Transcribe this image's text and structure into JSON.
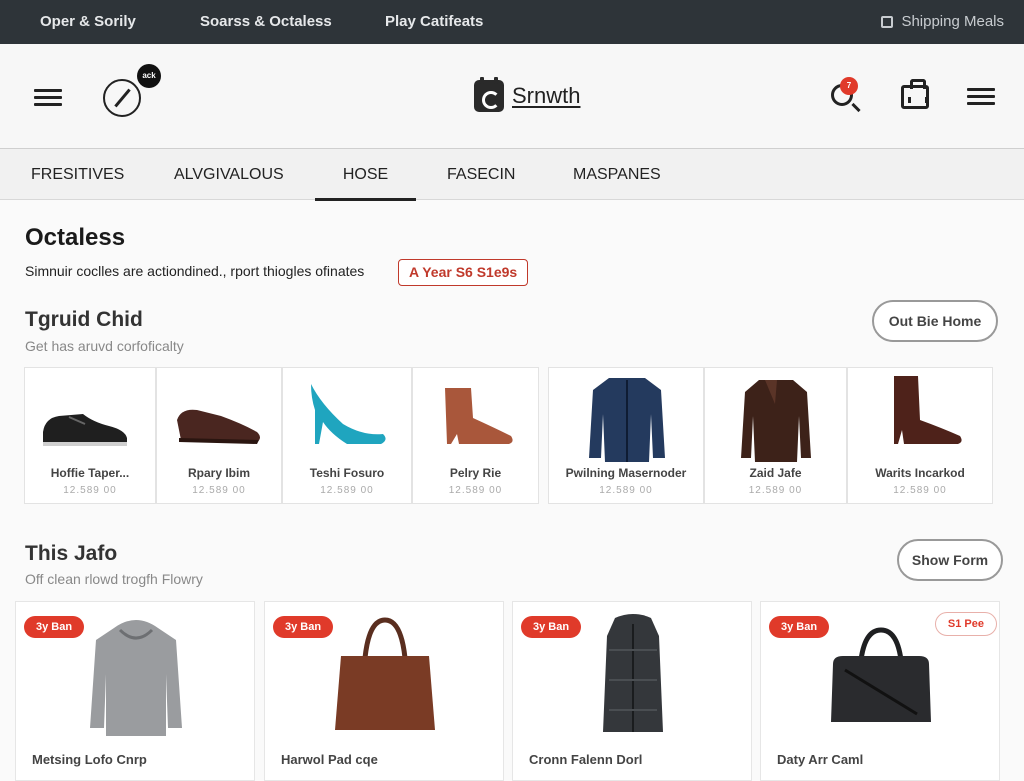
{
  "topbar": {
    "links": [
      "Oper & Sorily",
      "Soarss & Octaless",
      "Play Catifeats"
    ],
    "shipping": "Shipping Meals"
  },
  "header": {
    "compass_badge": "ack",
    "brand": "Srnwth",
    "search_badge": "7"
  },
  "tabs": [
    {
      "label": "FRESITIVES",
      "active": false
    },
    {
      "label": "ALVGIVALOUS",
      "active": false
    },
    {
      "label": "HOSE",
      "active": true
    },
    {
      "label": "FASECIN",
      "active": false
    },
    {
      "label": "MASPANES",
      "active": false
    }
  ],
  "main": {
    "title": "Octaless",
    "promo_text": "Simnuir coclles are actiondined., rport thiogles ofinates",
    "promo_badge": "A Year S6 S1e9s"
  },
  "section1": {
    "title": "Tgruid Chid",
    "subtitle": "Get has aruvd corfoficalty",
    "button": "Out Bie Home",
    "products": [
      {
        "name": "Hoffie Taper...",
        "price": "12.589 00",
        "icon": "oxford-shoe-icon"
      },
      {
        "name": "Rpary Ibim",
        "price": "12.589 00",
        "icon": "loafer-icon"
      },
      {
        "name": "Teshi Fosuro",
        "price": "12.589 00",
        "icon": "high-heel-icon"
      },
      {
        "name": "Pelry Rie",
        "price": "12.589 00",
        "icon": "ankle-boot-icon"
      },
      {
        "name": "Pwilning Masernoder",
        "price": "12.589 00",
        "icon": "jacket-icon"
      },
      {
        "name": "Zaid Jafe",
        "price": "12.589 00",
        "icon": "leather-jacket-icon"
      },
      {
        "name": "Warits Incarkod",
        "price": "12.589 00",
        "icon": "heeled-boot-icon"
      }
    ]
  },
  "section2": {
    "title": "This Jafo",
    "subtitle": "Off clean rlowd trogfh Flowry",
    "button": "Show Form",
    "cards": [
      {
        "sale": "3y Ban",
        "name": "Metsing Lofo Cnrp",
        "icon": "hoodie-icon"
      },
      {
        "sale": "3y Ban",
        "name": "Harwol Pad cqe",
        "icon": "tote-bag-icon"
      },
      {
        "sale": "3y Ban",
        "name": "Cronn Falenn Dorl",
        "icon": "vest-icon"
      },
      {
        "sale": "3y Ban",
        "name": "Daty Arr Caml",
        "icon": "duffel-bag-icon",
        "extra_badge": "S1 Pee"
      }
    ]
  },
  "colors": {
    "topbar": "#2e3439",
    "accent_red": "#e03a2a"
  }
}
